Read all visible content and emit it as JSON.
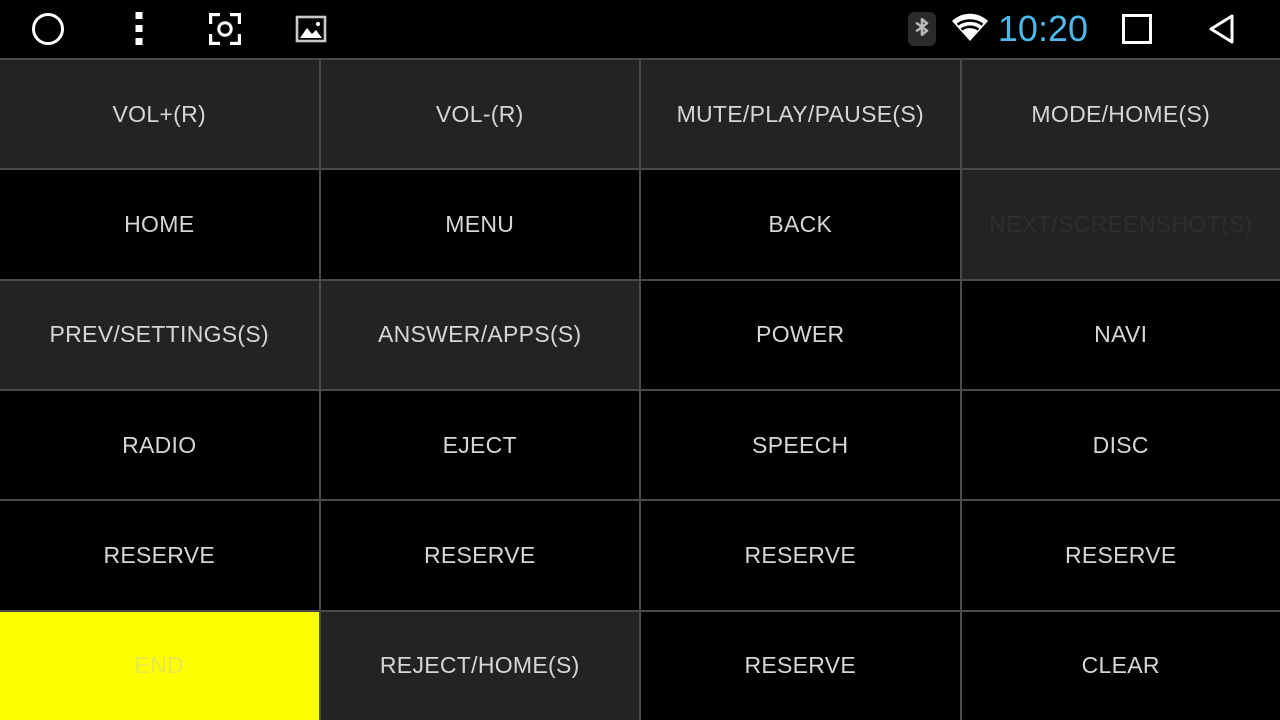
{
  "statusbar": {
    "left_icons": [
      {
        "name": "camera-shutter-icon",
        "glyph": "shutter"
      },
      {
        "name": "overflow-menu-icon",
        "glyph": "overflow"
      },
      {
        "name": "focus-viewfinder-icon",
        "glyph": "focus"
      },
      {
        "name": "gallery-image-icon",
        "glyph": "gallery"
      }
    ],
    "bluetooth_icon": "bluetooth-icon",
    "wifi_icon": "wifi-icon",
    "clock": "10:20",
    "clock_color": "#4fb8e8",
    "recents_icon": "recents-square-icon",
    "back_icon": "back-triangle-icon"
  },
  "grid": {
    "columns": 4,
    "rows": 6,
    "colors": {
      "cell_dark": "#000000",
      "cell_gray": "#232323",
      "highlight_yellow": "#ffff00",
      "label": "#d6d6d6",
      "label_disabled": "#2e2e2e",
      "gridline": "#4a4a4a"
    },
    "cells": [
      {
        "label": "VOL+(R)",
        "style": "gray",
        "row": 1,
        "col": 1
      },
      {
        "label": "VOL-(R)",
        "style": "gray",
        "row": 1,
        "col": 2
      },
      {
        "label": "MUTE/PLAY/PAUSE(S)",
        "style": "gray",
        "row": 1,
        "col": 3
      },
      {
        "label": "MODE/HOME(S)",
        "style": "gray",
        "row": 1,
        "col": 4
      },
      {
        "label": "HOME",
        "style": "black",
        "row": 2,
        "col": 1
      },
      {
        "label": "MENU",
        "style": "black",
        "row": 2,
        "col": 2
      },
      {
        "label": "BACK",
        "style": "black",
        "row": 2,
        "col": 3
      },
      {
        "label": "NEXT/SCREENSHOT(S)",
        "style": "dim",
        "row": 2,
        "col": 4
      },
      {
        "label": "PREV/SETTINGS(S)",
        "style": "gray",
        "row": 3,
        "col": 1
      },
      {
        "label": "ANSWER/APPS(S)",
        "style": "gray",
        "row": 3,
        "col": 2
      },
      {
        "label": "POWER",
        "style": "black",
        "row": 3,
        "col": 3
      },
      {
        "label": "NAVI",
        "style": "black",
        "row": 3,
        "col": 4
      },
      {
        "label": "RADIO",
        "style": "black",
        "row": 4,
        "col": 1
      },
      {
        "label": "EJECT",
        "style": "black",
        "row": 4,
        "col": 2
      },
      {
        "label": "SPEECH",
        "style": "black",
        "row": 4,
        "col": 3
      },
      {
        "label": "DISC",
        "style": "black",
        "row": 4,
        "col": 4
      },
      {
        "label": "RESERVE",
        "style": "black",
        "row": 5,
        "col": 1
      },
      {
        "label": "RESERVE",
        "style": "black",
        "row": 5,
        "col": 2
      },
      {
        "label": "RESERVE",
        "style": "black",
        "row": 5,
        "col": 3
      },
      {
        "label": "RESERVE",
        "style": "black",
        "row": 5,
        "col": 4
      },
      {
        "label": "END",
        "style": "yellow",
        "row": 6,
        "col": 1
      },
      {
        "label": "REJECT/HOME(S)",
        "style": "gray",
        "row": 6,
        "col": 2
      },
      {
        "label": "RESERVE",
        "style": "black",
        "row": 6,
        "col": 3
      },
      {
        "label": "CLEAR",
        "style": "black",
        "row": 6,
        "col": 4
      }
    ]
  }
}
